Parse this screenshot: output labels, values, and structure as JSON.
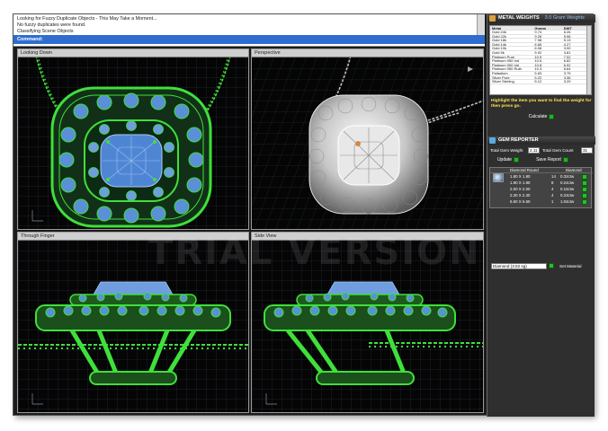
{
  "command": {
    "lines": [
      "Looking for Fuzzy Duplicate Objects - This May Take a Moment...",
      "No fuzzy duplicates were found.",
      "Classifying Scene Objects"
    ],
    "prompt": "Command:"
  },
  "viewports": [
    {
      "title": "Looking Down"
    },
    {
      "title": "Perspective"
    },
    {
      "title": "Through Finger"
    },
    {
      "title": "Side View"
    }
  ],
  "watermark": "TRIAL VERSION",
  "metal_panel": {
    "title": "METAL WEIGHTS",
    "accent": "3.0 Gram Weights",
    "columns": [
      "Metal",
      "Grams",
      "DWT"
    ],
    "rows": [
      [
        "Gold 24k",
        "9.74",
        "6.26"
      ],
      [
        "Gold 22k",
        "9.26",
        "5.96"
      ],
      [
        "Gold 18k",
        "7.98",
        "5.13"
      ],
      [
        "Gold 14k",
        "6.65",
        "4.27"
      ],
      [
        "Gold 10k",
        "6.06",
        "3.90"
      ],
      [
        "Gold 9k",
        "5.92",
        "3.81"
      ],
      [
        "Platinum Pure",
        "10.9",
        "7.02"
      ],
      [
        "Platinum 950 Ind",
        "10.6",
        "6.82"
      ],
      [
        "Platinum 900 Irid",
        "10.8",
        "6.92"
      ],
      [
        "Platinum 950 Ruth",
        "10.3",
        "6.64"
      ],
      [
        "Palladium",
        "5.83",
        "3.75"
      ],
      [
        "Silver Pure",
        "5.22",
        "3.36"
      ],
      [
        "Silver Sterling",
        "5.12",
        "3.29"
      ]
    ],
    "hint": "Highlight the item you want to find the weight for then press go.",
    "calculate_label": "Calculate"
  },
  "gem_panel": {
    "title": "GEM REPORTER",
    "total_weight_label": "Total Gem Weight",
    "total_weight_value": "2.11",
    "total_count_label": "Total Gem Count",
    "total_count_value": "31",
    "update_label": "Update",
    "save_label": "Save Report",
    "columns": [
      "Diamond Round",
      "Diamond"
    ],
    "rows": [
      [
        "1.80 X 1.80",
        "14",
        "0.32ctw"
      ],
      [
        "1.90 X 1.90",
        "8",
        "0.24ctw"
      ],
      [
        "2.00 X 2.00",
        "4",
        "0.15ctw"
      ],
      [
        "2.30 X 2.30",
        "4",
        "0.23ctw"
      ],
      [
        "6.60 X 6.60",
        "1",
        "1.04ctw"
      ]
    ],
    "material_select": "Diamond  (3.52 sg)",
    "set_material_label": "Set Material"
  },
  "colors": {
    "wire_green": "#3fe03a",
    "gem_blue": "#5b8fd8",
    "grid": "#2f3a48",
    "prompt_bar": "#2e6dd0",
    "hint_yellow": "#ffe84a"
  }
}
